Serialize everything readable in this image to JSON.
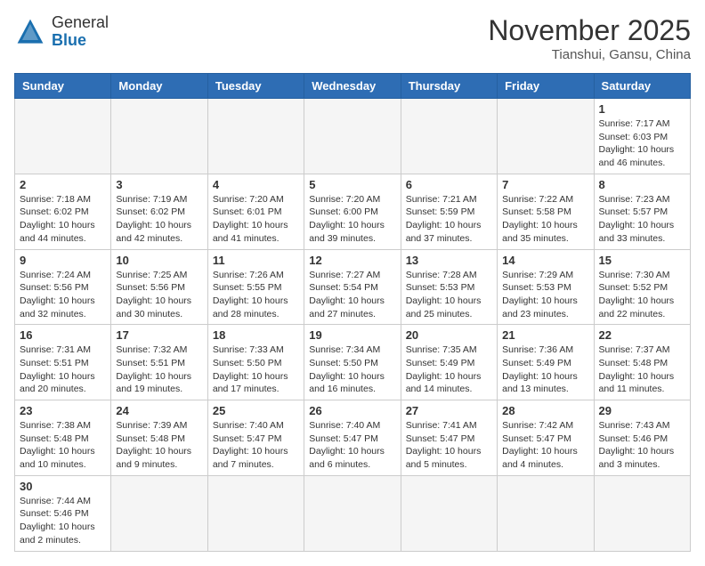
{
  "header": {
    "logo_general": "General",
    "logo_blue": "Blue",
    "month": "November 2025",
    "location": "Tianshui, Gansu, China"
  },
  "days_of_week": [
    "Sunday",
    "Monday",
    "Tuesday",
    "Wednesday",
    "Thursday",
    "Friday",
    "Saturday"
  ],
  "weeks": [
    [
      {
        "day": "",
        "info": ""
      },
      {
        "day": "",
        "info": ""
      },
      {
        "day": "",
        "info": ""
      },
      {
        "day": "",
        "info": ""
      },
      {
        "day": "",
        "info": ""
      },
      {
        "day": "",
        "info": ""
      },
      {
        "day": "1",
        "info": "Sunrise: 7:17 AM\nSunset: 6:03 PM\nDaylight: 10 hours and 46 minutes."
      }
    ],
    [
      {
        "day": "2",
        "info": "Sunrise: 7:18 AM\nSunset: 6:02 PM\nDaylight: 10 hours and 44 minutes."
      },
      {
        "day": "3",
        "info": "Sunrise: 7:19 AM\nSunset: 6:02 PM\nDaylight: 10 hours and 42 minutes."
      },
      {
        "day": "4",
        "info": "Sunrise: 7:20 AM\nSunset: 6:01 PM\nDaylight: 10 hours and 41 minutes."
      },
      {
        "day": "5",
        "info": "Sunrise: 7:20 AM\nSunset: 6:00 PM\nDaylight: 10 hours and 39 minutes."
      },
      {
        "day": "6",
        "info": "Sunrise: 7:21 AM\nSunset: 5:59 PM\nDaylight: 10 hours and 37 minutes."
      },
      {
        "day": "7",
        "info": "Sunrise: 7:22 AM\nSunset: 5:58 PM\nDaylight: 10 hours and 35 minutes."
      },
      {
        "day": "8",
        "info": "Sunrise: 7:23 AM\nSunset: 5:57 PM\nDaylight: 10 hours and 33 minutes."
      }
    ],
    [
      {
        "day": "9",
        "info": "Sunrise: 7:24 AM\nSunset: 5:56 PM\nDaylight: 10 hours and 32 minutes."
      },
      {
        "day": "10",
        "info": "Sunrise: 7:25 AM\nSunset: 5:56 PM\nDaylight: 10 hours and 30 minutes."
      },
      {
        "day": "11",
        "info": "Sunrise: 7:26 AM\nSunset: 5:55 PM\nDaylight: 10 hours and 28 minutes."
      },
      {
        "day": "12",
        "info": "Sunrise: 7:27 AM\nSunset: 5:54 PM\nDaylight: 10 hours and 27 minutes."
      },
      {
        "day": "13",
        "info": "Sunrise: 7:28 AM\nSunset: 5:53 PM\nDaylight: 10 hours and 25 minutes."
      },
      {
        "day": "14",
        "info": "Sunrise: 7:29 AM\nSunset: 5:53 PM\nDaylight: 10 hours and 23 minutes."
      },
      {
        "day": "15",
        "info": "Sunrise: 7:30 AM\nSunset: 5:52 PM\nDaylight: 10 hours and 22 minutes."
      }
    ],
    [
      {
        "day": "16",
        "info": "Sunrise: 7:31 AM\nSunset: 5:51 PM\nDaylight: 10 hours and 20 minutes."
      },
      {
        "day": "17",
        "info": "Sunrise: 7:32 AM\nSunset: 5:51 PM\nDaylight: 10 hours and 19 minutes."
      },
      {
        "day": "18",
        "info": "Sunrise: 7:33 AM\nSunset: 5:50 PM\nDaylight: 10 hours and 17 minutes."
      },
      {
        "day": "19",
        "info": "Sunrise: 7:34 AM\nSunset: 5:50 PM\nDaylight: 10 hours and 16 minutes."
      },
      {
        "day": "20",
        "info": "Sunrise: 7:35 AM\nSunset: 5:49 PM\nDaylight: 10 hours and 14 minutes."
      },
      {
        "day": "21",
        "info": "Sunrise: 7:36 AM\nSunset: 5:49 PM\nDaylight: 10 hours and 13 minutes."
      },
      {
        "day": "22",
        "info": "Sunrise: 7:37 AM\nSunset: 5:48 PM\nDaylight: 10 hours and 11 minutes."
      }
    ],
    [
      {
        "day": "23",
        "info": "Sunrise: 7:38 AM\nSunset: 5:48 PM\nDaylight: 10 hours and 10 minutes."
      },
      {
        "day": "24",
        "info": "Sunrise: 7:39 AM\nSunset: 5:48 PM\nDaylight: 10 hours and 9 minutes."
      },
      {
        "day": "25",
        "info": "Sunrise: 7:40 AM\nSunset: 5:47 PM\nDaylight: 10 hours and 7 minutes."
      },
      {
        "day": "26",
        "info": "Sunrise: 7:40 AM\nSunset: 5:47 PM\nDaylight: 10 hours and 6 minutes."
      },
      {
        "day": "27",
        "info": "Sunrise: 7:41 AM\nSunset: 5:47 PM\nDaylight: 10 hours and 5 minutes."
      },
      {
        "day": "28",
        "info": "Sunrise: 7:42 AM\nSunset: 5:47 PM\nDaylight: 10 hours and 4 minutes."
      },
      {
        "day": "29",
        "info": "Sunrise: 7:43 AM\nSunset: 5:46 PM\nDaylight: 10 hours and 3 minutes."
      }
    ],
    [
      {
        "day": "30",
        "info": "Sunrise: 7:44 AM\nSunset: 5:46 PM\nDaylight: 10 hours and 2 minutes."
      },
      {
        "day": "",
        "info": ""
      },
      {
        "day": "",
        "info": ""
      },
      {
        "day": "",
        "info": ""
      },
      {
        "day": "",
        "info": ""
      },
      {
        "day": "",
        "info": ""
      },
      {
        "day": "",
        "info": ""
      }
    ]
  ]
}
